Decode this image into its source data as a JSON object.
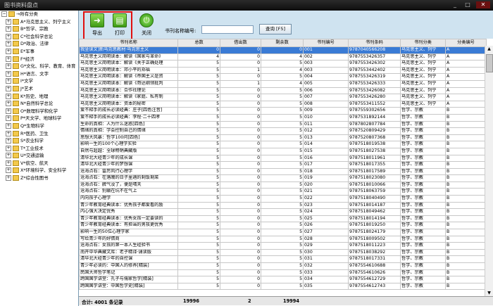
{
  "window": {
    "title": "图书资料盘点"
  },
  "tree": {
    "root": "→所有分类",
    "items": [
      "A*马克思主义、列宁主义",
      "B*哲学、宗教",
      "C*社会科学总论",
      "D*政治、法律",
      "E*军事",
      "F*经济",
      "G*文化、科学、教育、体育",
      "H*语言、文字",
      "I*文学",
      "J*艺术",
      "K*历史、地理",
      "N*自然科学总论",
      "O*数理科学和化学",
      "P*天文学、地球科学",
      "Q*生物科学",
      "R*医药、卫生",
      "S*农业科学",
      "T*工业技术",
      "U*交通运输",
      "V*航空、航天",
      "X*环境科学、安全科学",
      "Z*综合性图书"
    ]
  },
  "toolbar": {
    "export": "导出",
    "print": "打印",
    "close": "关闭",
    "search_label": "书刊名称编号:",
    "query": "查询 [F5]"
  },
  "grid": {
    "headers": [
      "书刊名称",
      "总数",
      "借出数",
      "剩余数",
      "书刊编号",
      "书刊条码",
      "书刊分类",
      "分类编号"
    ],
    "rows": [
      [
        "我坐读文]新马克思教材·马克思主义",
        "0",
        "0",
        "0",
        "001",
        "9787040566208",
        "马克思主义、列宁",
        "A"
      ],
      [
        "马克思主义简明读本：解读《国家与革命》",
        "4",
        "0",
        "4",
        "002",
        "9787553426357",
        "马克思主义、列宁",
        "A"
      ],
      [
        "马克思主义简明读本：解读《关于正确处理",
        "5",
        "0",
        "5",
        "003",
        "9787553426302",
        "马克思主义、列宁",
        "A"
      ],
      [
        "马克思主义简明读本：邓小平的郑福",
        "5",
        "1",
        "4",
        "003",
        "9787553442402",
        "马克思主义、列宁",
        "A"
      ],
      [
        "马克思主义简明读本：解读《帝国主义是资",
        "5",
        "0",
        "5",
        "004",
        "9787553426319",
        "马克思主义、列宁",
        "A"
      ],
      [
        "马克思主义简明读本：解读《哥达纲领批判",
        "5",
        "1",
        "4",
        "005",
        "9787553426333",
        "马克思主义、列宁",
        "A"
      ],
      [
        "马克思主义简明读本：合作社理论",
        "5",
        "0",
        "5",
        "006",
        "9787553426082",
        "马克思主义、列宁",
        "A"
      ],
      [
        "马克思主义简明读本：解读《家庭、私有制",
        "5",
        "0",
        "5",
        "007",
        "9787553426280",
        "马克思主义、列宁",
        "A"
      ],
      [
        "马克思主义简明读本：资本的秘密",
        "5",
        "0",
        "5",
        "008",
        "9787553411552",
        "马克思主义、列宁",
        "A"
      ],
      [
        "爱不释手的成长必读经典：庄子[四色注音]",
        "5",
        "0",
        "5",
        "009",
        "9787559302656",
        "哲学、宗教",
        "B"
      ],
      [
        "爱不释手的成长必读经典：李程·二十四孝",
        "5",
        "0",
        "5",
        "010",
        "9787531892144",
        "哲学、宗教",
        "B"
      ],
      [
        "生命的真相：人为什么迷惑[四色]",
        "5",
        "0",
        "5",
        "011",
        "9787802807784",
        "哲学、宗教",
        "B"
      ],
      [
        "情绪的真相：学会控制自己的情绪",
        "5",
        "0",
        "5",
        "012",
        "9787520809429",
        "哲学、宗教",
        "B"
      ],
      [
        "思想大风暴：哲学100问[四色]",
        "5",
        "0",
        "5",
        "013",
        "9787520807368",
        "哲学、宗教",
        "B"
      ],
      [
        "影响一生的100个心理学实验",
        "5",
        "0",
        "5",
        "014",
        "9787518019538",
        "哲学、宗教",
        "B"
      ],
      [
        "自然与超越：全球畅销典藏版",
        "5",
        "0",
        "5",
        "015",
        "9787518027538",
        "哲学、宗教",
        "B"
      ],
      [
        "清华北大经青少年的成长课",
        "5",
        "0",
        "5",
        "016",
        "9787518011961",
        "哲学、宗教",
        "B"
      ],
      [
        "清华北大经青少年的梦想课",
        "5",
        "0",
        "5",
        "017",
        "9787518017355",
        "哲学、宗教",
        "B"
      ],
      [
        "沧海点石：雷厉风行心理学",
        "5",
        "0",
        "5",
        "018",
        "9787518017589",
        "哲学、宗教",
        "B"
      ],
      [
        "沧海点石：在落魄的日子里遇的剩饭剩菜",
        "5",
        "0",
        "5",
        "019",
        "9787518023080",
        "哲学、宗教",
        "B"
      ],
      [
        "沧海点石：脾气没了，便是晴天",
        "5",
        "0",
        "5",
        "020",
        "9787518010066",
        "哲学、宗教",
        "B"
      ],
      [
        "沧海点石：别躺在坑不在气上",
        "5",
        "0",
        "5",
        "021",
        "9787518063759",
        "哲学、宗教",
        "B"
      ],
      [
        "内向孩子心理学",
        "5",
        "0",
        "5",
        "022",
        "9787518040490",
        "哲学、宗教",
        "B"
      ],
      [
        "青少年教育经典读本：优秀孩子都爱看的励",
        "5",
        "0",
        "5",
        "023",
        "9787518014187",
        "哲学、宗教",
        "B"
      ],
      [
        "内心强大决定优秀",
        "5",
        "0",
        "5",
        "024",
        "9787518049462",
        "哲学、宗教",
        "B"
      ],
      [
        "青少年教育经典读本：优秀女孩一定要读的",
        "5",
        "0",
        "5",
        "025",
        "9787518014194",
        "哲学、宗教",
        "B"
      ],
      [
        "青少年教育经典读本：有担当的男孩更优秀",
        "5",
        "0",
        "5",
        "026",
        "9787518019250",
        "哲学、宗教",
        "B"
      ],
      [
        "影响一生的50位心理学家",
        "5",
        "0",
        "5",
        "027",
        "9787518024179",
        "哲学、宗教",
        "B"
      ],
      [
        "写给青少年的好情商",
        "5",
        "0",
        "5",
        "028",
        "9787518009502",
        "哲学、宗教",
        "B"
      ],
      [
        "沧海点石：女孩的第一本人生经验书",
        "5",
        "0",
        "5",
        "029",
        "9787518011223",
        "哲学、宗教",
        "B"
      ],
      [
        "南开中华典藏文库：老子精译·诵读版",
        "5",
        "0",
        "5",
        "030",
        "9787518038292",
        "哲学、宗教",
        "B"
      ],
      [
        "清华北大经青少年的自控课",
        "5",
        "0",
        "5",
        "031",
        "9787518017331",
        "哲学、宗教",
        "B"
      ],
      [
        "青少年必读的：中国人的修养[精装]",
        "5",
        "0",
        "5",
        "032",
        "9787554610688",
        "哲学、宗教",
        "B"
      ],
      [
        "民国大师哲学笔记",
        "5",
        "0",
        "5",
        "033",
        "9787554610626",
        "哲学、宗教",
        "B"
      ],
      [
        "跨国国学讲堂：孔子与儒家哲学[精装]",
        "5",
        "0",
        "5",
        "034",
        "9787554612729",
        "哲学、宗教",
        "B"
      ],
      [
        "跨国国学讲堂：中国哲学史[精装]",
        "5",
        "0",
        "5",
        "035",
        "9787554612743",
        "哲学、宗教",
        "B"
      ]
    ]
  },
  "footer": {
    "label": "合计: 4001 条记录",
    "total": "19996",
    "lent": "2",
    "remain": "19994"
  }
}
